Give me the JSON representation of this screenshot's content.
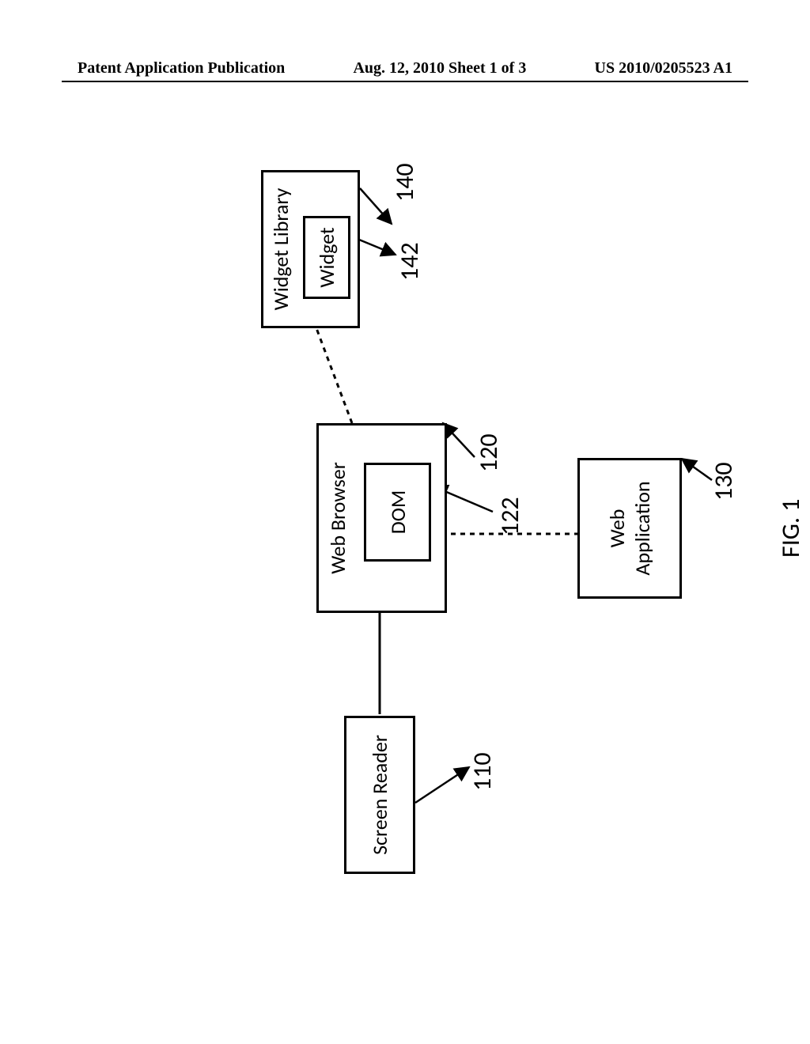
{
  "header": {
    "left": "Patent Application Publication",
    "center": "Aug. 12, 2010  Sheet 1 of 3",
    "right": "US 2010/0205523 A1"
  },
  "figure": {
    "caption": "FIG. 1",
    "boxes": {
      "screen_reader": "Screen Reader",
      "web_browser": "Web Browser",
      "dom": "DOM",
      "widget_library": "Widget Library",
      "widget": "Widget",
      "web_application": "Web\nApplication"
    },
    "refs": {
      "screen_reader": "110",
      "web_browser": "120",
      "dom": "122",
      "widget_library": "140",
      "widget": "142",
      "web_application": "130"
    }
  }
}
